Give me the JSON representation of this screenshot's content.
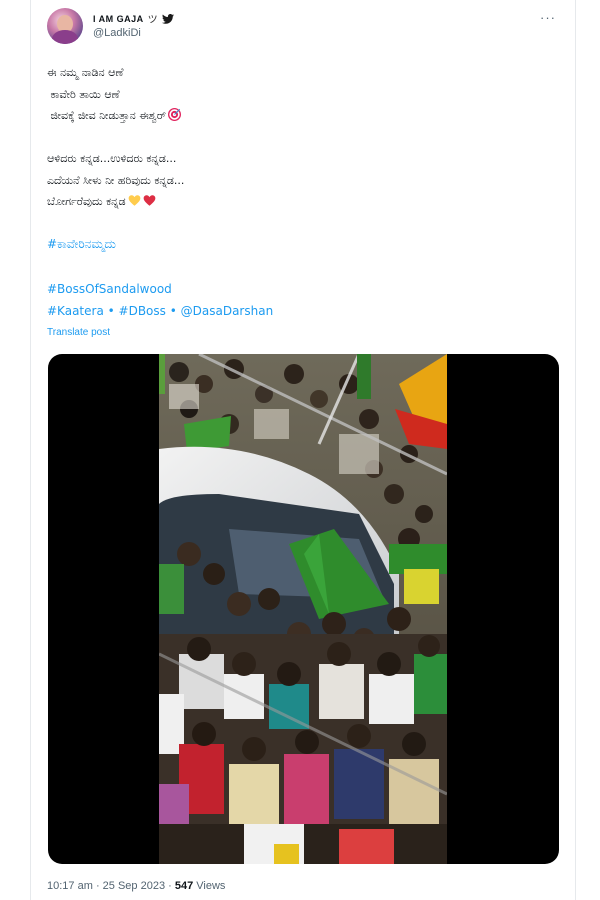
{
  "author": {
    "display_name": "I AM GAJA",
    "name_glyph": "ツ",
    "handle": "@LadkiDi"
  },
  "tweet": {
    "lines": [
      "ಈ ನಮ್ಮ ನಾಡಿನ ಆಣೆ",
      " ಕಾವೇರಿ ತಾಯಿ ಆಣೆ",
      " ಜೀವಕ್ಕೆ ಜೀವ ನೀಡುತ್ತಾನ ಈಶ್ವರ್",
      "",
      "ಆಳಿದರು ಕನ್ನಡ...ಉಳಿದರು ಕನ್ನಡ...",
      "ಎದೆಯನೆ ಸೀಳು ನೀ ಹರಿವುದು ಕನ್ನಡ...",
      "ಬೋರ್ಗರೆವುದು ಕನ್ನಡ"
    ],
    "hashtag_kaveri": "#ಕಾವೇರಿನಮ್ಮದು",
    "hashtag_boss": "#BossOfSandalwood",
    "hashtag_kaatera": "#Kaatera",
    "hashtag_dboss": "#DBoss",
    "mention": "@DasaDarshan",
    "separator": "•",
    "translate_label": "Translate post"
  },
  "footer": {
    "time": "10:17 am",
    "separator": "·",
    "date": "25 Sep 2023",
    "views_count": "547",
    "views_label": "Views"
  },
  "icons": {
    "verified": "twitter-bird-icon",
    "more": "more-options-icon",
    "target_emoji": "direct-hit-emoji",
    "yellow_heart": "yellow-heart-emoji",
    "red_heart": "red-heart-emoji"
  },
  "colors": {
    "link": "#1d9bf0",
    "secondary_text": "#536471",
    "primary_text": "#0f1419",
    "media_background": "#000000"
  }
}
